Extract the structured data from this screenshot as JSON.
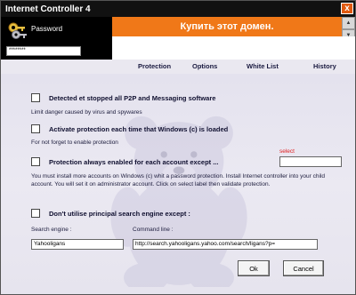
{
  "window": {
    "title": "Internet Controller 4",
    "close_glyph": "x"
  },
  "login": {
    "password_label": "Password",
    "password_value": "********"
  },
  "banner": {
    "text": "Купить этот домен."
  },
  "tabs": [
    {
      "label": "Protection"
    },
    {
      "label": "Options"
    },
    {
      "label": "White List"
    },
    {
      "label": "History"
    }
  ],
  "options": {
    "p2p": {
      "label": "Detected et stopped all P2P and Messaging software",
      "desc": "Limit danger caused by virus and spywares",
      "checked": false
    },
    "activate": {
      "label": "Activate protection each time that Windows (c) is loaded",
      "desc": "For not forget to enable protection",
      "checked": false
    },
    "always": {
      "label": "Protection always enabled for each account except ...",
      "desc": "You must install more accounts on Windows (c) whit a password protection. Install Internet controller into your child account. You will set it on administrator account. Click on select label then validate protection.",
      "select_label": "select",
      "account_value": "",
      "checked": false
    },
    "search": {
      "label": "Don't utilise principal search engine except :",
      "engine_label": "Search engine :",
      "engine_value": "Yahooligans",
      "command_label": "Command line :",
      "command_value": "http://search.yahooligans.yahoo.com/search/ligans?p=",
      "checked": false
    }
  },
  "buttons": {
    "ok": "Ok",
    "cancel": "Cancel"
  },
  "colors": {
    "banner": "#f07818",
    "titlebar": "#111111",
    "select": "#e02020"
  },
  "icons": {
    "keys": "keys-icon",
    "bear": "teddy-bear-watermark"
  }
}
